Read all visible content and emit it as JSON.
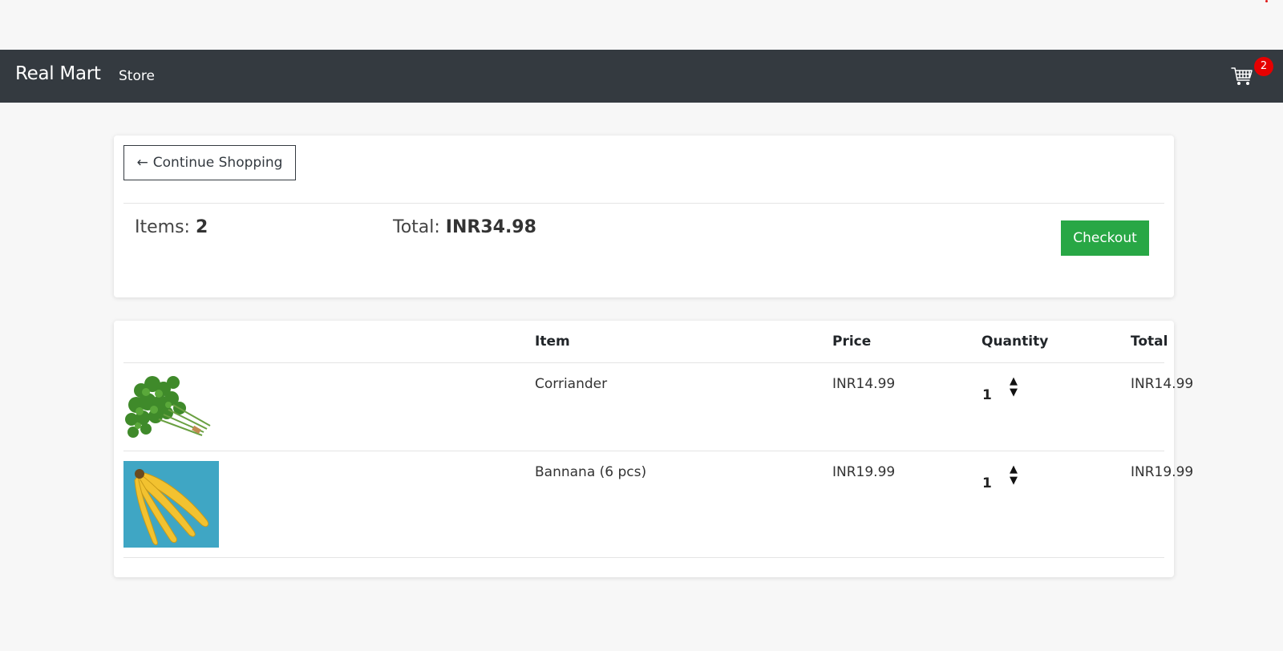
{
  "navbar": {
    "brand": "Real Mart",
    "links": [
      "Store"
    ],
    "cart_count": "2"
  },
  "summary": {
    "continue_label": "Continue Shopping",
    "items_label": "Items:",
    "items_value": "2",
    "total_label": "Total:",
    "total_value": "INR34.98",
    "checkout_label": "Checkout"
  },
  "table": {
    "headers": {
      "item": "Item",
      "price": "Price",
      "quantity": "Quantity",
      "total": "Total"
    },
    "rows": [
      {
        "name": "Corriander",
        "price": "INR14.99",
        "quantity": "1",
        "total": "INR14.99",
        "image": "coriander-image"
      },
      {
        "name": "Bannana (6 pcs)",
        "price": "INR19.99",
        "quantity": "1",
        "total": "INR19.99",
        "image": "banana-image"
      }
    ]
  },
  "colors": {
    "navbar_bg": "#343a40",
    "checkout_bg": "#28a745",
    "badge_bg": "#e60000",
    "page_bg": "#f7f7f7"
  }
}
